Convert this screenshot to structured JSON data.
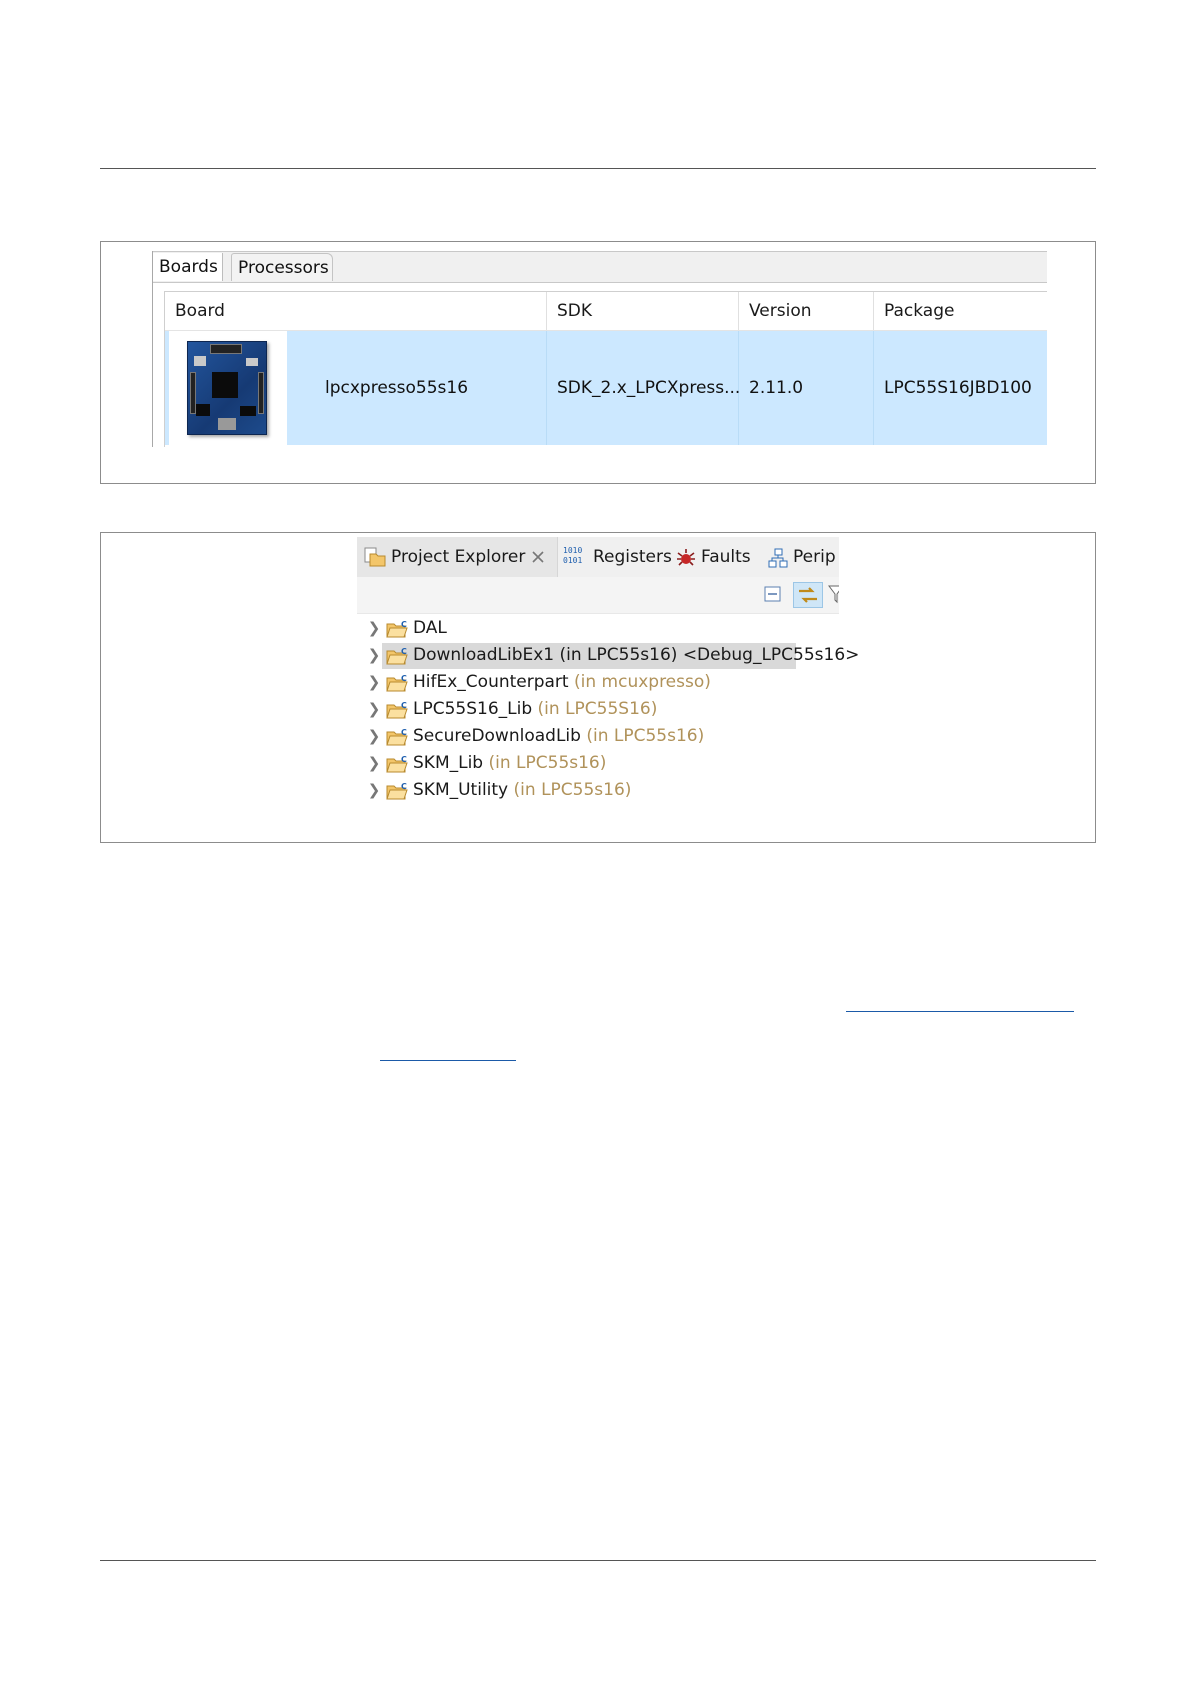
{
  "boards_dialog": {
    "tabs": [
      {
        "label": "Boards",
        "active": true
      },
      {
        "label": "Processors",
        "active": false
      }
    ],
    "columns": [
      "Board",
      "SDK",
      "Version",
      "Package"
    ],
    "rows": [
      {
        "board": "lpcxpresso55s16",
        "sdk": "SDK_2.x_LPCXpress...",
        "version": "2.11.0",
        "package": "LPC55S16JBD100",
        "selected": true
      }
    ],
    "selection_color": "#cce8ff"
  },
  "project_explorer": {
    "tabs": [
      {
        "label": "Project Explorer",
        "icon": "project-explorer-icon",
        "active": true,
        "closable": true
      },
      {
        "label": "Registers",
        "icon": "registers-icon",
        "active": false
      },
      {
        "label": "Faults",
        "icon": "faults-icon",
        "active": false
      },
      {
        "label": "Perip",
        "icon": "peripherals-icon",
        "active": false
      }
    ],
    "toolbar": [
      {
        "icon": "collapse-all-icon"
      },
      {
        "icon": "link-with-editor-icon",
        "pressed": true
      },
      {
        "icon": "filter-icon"
      }
    ],
    "projects": [
      {
        "name": "DAL",
        "context": "",
        "config": ""
      },
      {
        "name": "DownloadLibEx1",
        "context": "(in LPC55s16)",
        "config": "<Debug_LPC55s16>",
        "selected": true
      },
      {
        "name": "HifEx_Counterpart",
        "context": "(in mcuxpresso)",
        "config": ""
      },
      {
        "name": "LPC55S16_Lib",
        "context": "(in LPC55S16)",
        "config": ""
      },
      {
        "name": "SecureDownloadLib",
        "context": "(in LPC55s16)",
        "config": ""
      },
      {
        "name": "SKM_Lib",
        "context": "(in LPC55s16)",
        "config": ""
      },
      {
        "name": "SKM_Utility",
        "context": "(in LPC55s16)",
        "config": ""
      }
    ],
    "context_text_color": "#b0925a"
  }
}
